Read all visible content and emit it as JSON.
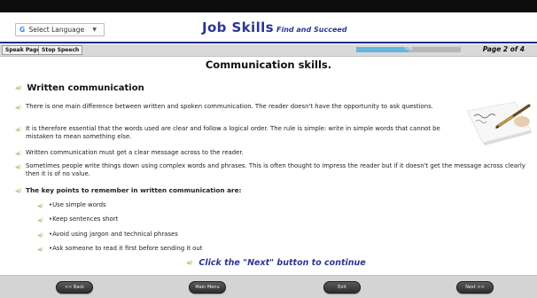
{
  "header": {
    "language_selector": "Select Language",
    "language_icon": "G",
    "language_arrow": "▼",
    "title": "Job Skills",
    "subtitle": "Find and Succeed"
  },
  "toolbar": {
    "speak_page": "Speak Page",
    "stop_speech": "Stop Speech",
    "progress_label": "50%",
    "progress_fraction": 0.5,
    "page_indicator": "Page 2 of 4"
  },
  "main": {
    "page_title": "Communication skills.",
    "section_heading": "Written communication",
    "paragraphs": [
      "There is one main difference between written and spoken communication. The reader doesn't have the opportunity to ask questions.",
      "It is therefore essential that the words used are clear and follow a logical order. The rule is simple: write in simple words that cannot be mistaken to mean something else.",
      "Written communication must get a clear message across to the reader.",
      "Sometimes people write things down using complex words and phrases. This is often thought to impress the reader but if it doesn't get the message across clearly then it is of no value."
    ],
    "key_points_heading": "The key points to remember in written communication are:",
    "key_points": [
      "•Use simple words",
      "•Keep sentences short",
      "•Avoid using jargon and technical phrases",
      "•Ask someone to read it first before sending it out"
    ],
    "next_note": "Click the \"Next\" button to continue",
    "speaker_icon": "speaker-icon",
    "image_icon": "pen-writing-image"
  },
  "footer": {
    "back": "<< Back",
    "main_menu": "Main Menu",
    "exit": "Exit",
    "next": "Next >>"
  },
  "colors": {
    "brand_blue": "#2e3592",
    "progress_fill": "#66b6dd",
    "speaker_icon": "#c6c29a"
  }
}
